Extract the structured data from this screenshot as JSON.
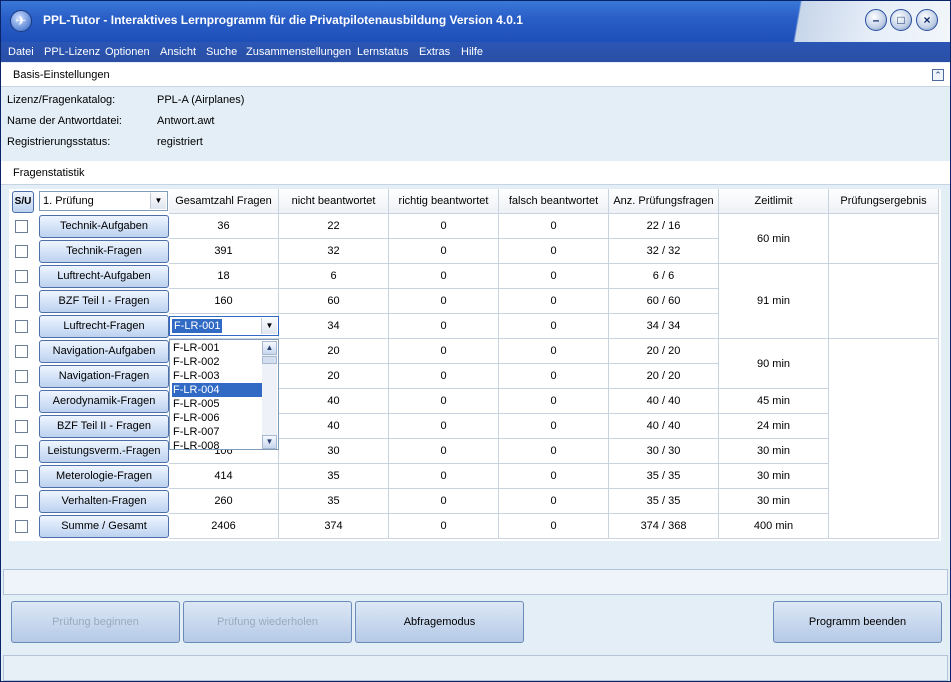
{
  "window": {
    "title": "PPL-Tutor  -  Interaktives Lernprogramm für die Privatpilotenausbildung Version 4.0.1"
  },
  "menu": [
    "Datei",
    "PPL-Lizenz",
    "Optionen",
    "Ansicht",
    "Suche",
    "Zusammenstellungen",
    "Lernstatus",
    "Extras",
    "Hilfe"
  ],
  "basis": {
    "title": "Basis-Einstellungen",
    "lizenz_label": "Lizenz/Fragenkatalog:",
    "lizenz_value": "PPL-A (Airplanes)",
    "antwort_label": "Name der Antwortdatei:",
    "antwort_value": "Antwort.awt",
    "reg_label": "Registrierungsstatus:",
    "reg_value": "registriert"
  },
  "stats": {
    "title": "Fragenstatistik",
    "sj_label": "S/U",
    "pruefung_select": "1. Prüfung",
    "headers": [
      "Gesamtzahl Fragen",
      "nicht beantwortet",
      "richtig beantwortet",
      "falsch beantwortet",
      "Anz. Prüfungsfragen",
      "Zeitlimit",
      "Prüfungsergebnis"
    ],
    "rows": [
      {
        "label": "Technik-Aufgaben",
        "total": "36",
        "nicht": "22",
        "richtig": "0",
        "falsch": "0",
        "anz": "22 / 16"
      },
      {
        "label": "Technik-Fragen",
        "total": "391",
        "nicht": "32",
        "richtig": "0",
        "falsch": "0",
        "anz": "32 / 32"
      },
      {
        "label": "Luftrecht-Aufgaben",
        "total": "18",
        "nicht": "6",
        "richtig": "0",
        "falsch": "0",
        "anz": "6 / 6"
      },
      {
        "label": "BZF Teil I - Fragen",
        "total": "160",
        "nicht": "60",
        "richtig": "0",
        "falsch": "0",
        "anz": "60 / 60"
      },
      {
        "label": "Luftrecht-Fragen",
        "total": "",
        "nicht": "34",
        "richtig": "0",
        "falsch": "0",
        "anz": "34 / 34"
      },
      {
        "label": "Navigation-Aufgaben",
        "total": "",
        "nicht": "20",
        "richtig": "0",
        "falsch": "0",
        "anz": "20 / 20"
      },
      {
        "label": "Navigation-Fragen",
        "total": "",
        "nicht": "20",
        "richtig": "0",
        "falsch": "0",
        "anz": "20 / 20"
      },
      {
        "label": "Aerodynamik-Fragen",
        "total": "",
        "nicht": "40",
        "richtig": "0",
        "falsch": "0",
        "anz": "40 / 40"
      },
      {
        "label": "BZF Teil II - Fragen",
        "total": "",
        "nicht": "40",
        "richtig": "0",
        "falsch": "0",
        "anz": "40 / 40"
      },
      {
        "label": "Leistungsverm.-Fragen",
        "total": "106",
        "nicht": "30",
        "richtig": "0",
        "falsch": "0",
        "anz": "30 / 30"
      },
      {
        "label": "Meterologie-Fragen",
        "total": "414",
        "nicht": "35",
        "richtig": "0",
        "falsch": "0",
        "anz": "35 / 35"
      },
      {
        "label": "Verhalten-Fragen",
        "total": "260",
        "nicht": "35",
        "richtig": "0",
        "falsch": "0",
        "anz": "35 / 35"
      },
      {
        "label": "Summe / Gesamt",
        "total": "2406",
        "nicht": "374",
        "richtig": "0",
        "falsch": "0",
        "anz": "374 / 368"
      }
    ],
    "zeit": {
      "z1": "60 min",
      "z2": "91 min",
      "z3": "90 min",
      "z4": "45 min",
      "z5": "24 min",
      "z6": "30 min",
      "z7": "30 min",
      "z8": "30 min",
      "z9": "400 min"
    },
    "combo_value": "F-LR-001",
    "dropdown_items": [
      "F-LR-001",
      "F-LR-002",
      "F-LR-003",
      "F-LR-004",
      "F-LR-005",
      "F-LR-006",
      "F-LR-007",
      "F-LR-008"
    ],
    "dropdown_selected": "F-LR-004"
  },
  "buttons": {
    "beginnen": "Prüfung beginnen",
    "wiederholen": "Prüfung wiederholen",
    "abfrage": "Abfragemodus",
    "beenden": "Programm beenden"
  }
}
